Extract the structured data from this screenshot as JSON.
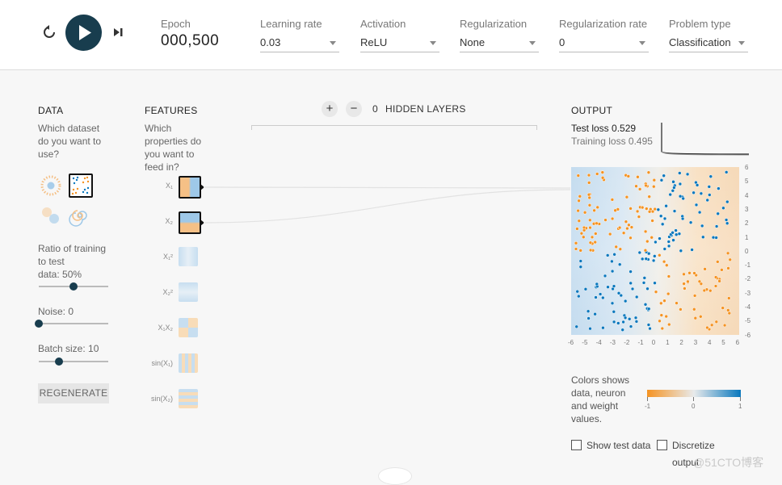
{
  "controls": {
    "reset_icon": "reset-icon",
    "play_icon": "play-icon",
    "step_icon": "step-icon"
  },
  "epoch": {
    "label": "Epoch",
    "value": "000,500"
  },
  "params": [
    {
      "label": "Learning rate",
      "value": "0.03"
    },
    {
      "label": "Activation",
      "value": "ReLU"
    },
    {
      "label": "Regularization",
      "value": "None"
    },
    {
      "label": "Regularization rate",
      "value": "0"
    },
    {
      "label": "Problem type",
      "value": "Classification"
    }
  ],
  "data_section": {
    "title": "DATA",
    "question": [
      "Which dataset",
      "do you want to",
      "use?"
    ],
    "ratio_label": [
      "Ratio of training",
      "to test",
      "data:  50%"
    ],
    "ratio_value": 0.5,
    "noise_label": "Noise:  0",
    "noise_value": 0,
    "batch_label": "Batch size:  10",
    "batch_value": 0.29,
    "regenerate_label": "REGENERATE"
  },
  "features_section": {
    "title": "FEATURES",
    "question": [
      "Which",
      "properties do",
      "you want to",
      "feed in?"
    ],
    "features": [
      {
        "label": "X₁",
        "active": true
      },
      {
        "label": "X₂",
        "active": true
      },
      {
        "label": "X₁²",
        "active": false
      },
      {
        "label": "X₂²",
        "active": false
      },
      {
        "label": "X₁X₂",
        "active": false
      },
      {
        "label": "sin(X₁)",
        "active": false
      },
      {
        "label": "sin(X₂)",
        "active": false
      }
    ]
  },
  "hidden_layers": {
    "plus": "+",
    "minus": "−",
    "count": "0",
    "label": "HIDDEN LAYERS"
  },
  "output": {
    "title": "OUTPUT",
    "test_loss": "Test loss 0.529",
    "training_loss": "Training loss 0.495",
    "x_ticks": [
      "-6",
      "-5",
      "-4",
      "-3",
      "-2",
      "-1",
      "0",
      "1",
      "2",
      "3",
      "4",
      "5",
      "6"
    ],
    "y_ticks": [
      "6",
      "5",
      "4",
      "3",
      "2",
      "1",
      "0",
      "-1",
      "-2",
      "-3",
      "-4",
      "-5",
      "-6"
    ],
    "legend_text": [
      "Colors shows",
      "data, neuron",
      "and weight",
      "values."
    ],
    "legend_ticks": [
      "-1",
      "0",
      "1"
    ],
    "show_test_label": "Show test data",
    "discretize_label": "Discretize",
    "discretize_label2": "output"
  },
  "colors": {
    "orange": "#f59322",
    "blue": "#0877bd",
    "dark": "#183d4e"
  },
  "watermark": "@51CTO博客"
}
